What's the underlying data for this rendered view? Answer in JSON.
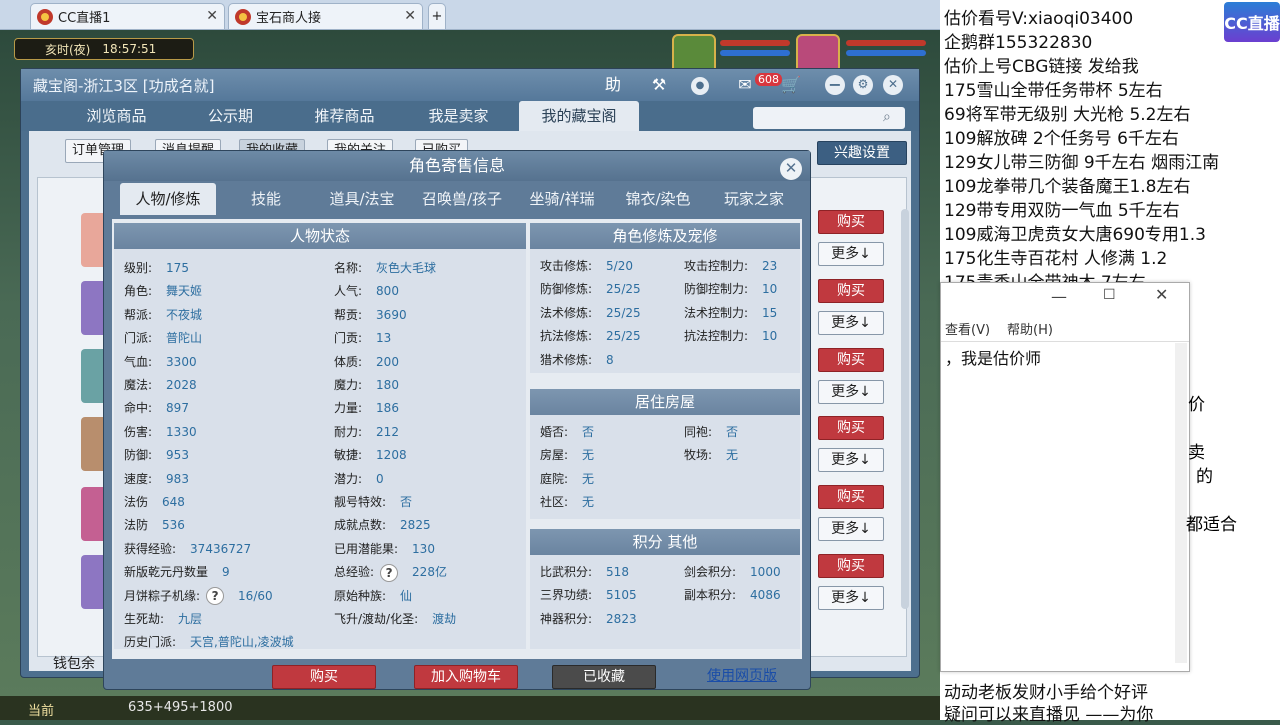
{
  "browser": {
    "tabs": [
      {
        "label": "CC直播1"
      },
      {
        "label": "宝石商人接"
      }
    ],
    "new_tab": "+"
  },
  "game": {
    "clock_label": "亥时(夜)",
    "time": "18:57:51",
    "coords": "635+495+1800",
    "bottom_label": "当前"
  },
  "cbg": {
    "title": "藏宝阁-浙江3区 [功成名就]",
    "help": "助",
    "badge": "608",
    "nav": [
      "浏览商品",
      "公示期",
      "推荐商品",
      "我是卖家",
      "我的藏宝阁"
    ],
    "subtabs": [
      "订单管理",
      "消息提醒",
      "我的收藏",
      "我的关注",
      "已购买",
      "浏览记录"
    ],
    "xingqu": "兴趣设置",
    "buy": "购买",
    "more": "更多↓",
    "wallet": "钱包余"
  },
  "modal": {
    "title": "角色寄售信息",
    "tabs": [
      "人物/修炼",
      "技能",
      "道具/法宝",
      "召唤兽/孩子",
      "坐骑/祥瑞",
      "锦衣/染色",
      "玩家之家"
    ],
    "status": {
      "title": "人物状态",
      "left": [
        {
          "k": "级别:",
          "v": "175"
        },
        {
          "k": "角色:",
          "v": "舞天姬"
        },
        {
          "k": "帮派:",
          "v": "不夜城"
        },
        {
          "k": "门派:",
          "v": "普陀山"
        },
        {
          "k": "气血:",
          "v": "3300"
        },
        {
          "k": "魔法:",
          "v": "2028"
        },
        {
          "k": "命中:",
          "v": "897"
        },
        {
          "k": "伤害:",
          "v": "1330"
        },
        {
          "k": "防御:",
          "v": "953"
        },
        {
          "k": "速度:",
          "v": "983"
        },
        {
          "k": "法伤",
          "v": "648"
        },
        {
          "k": "法防",
          "v": "536"
        },
        {
          "k": "获得经验:",
          "v": "37436727"
        },
        {
          "k": "新版乾元丹数量",
          "v": "9"
        },
        {
          "k": "月饼粽子机缘:",
          "v": "16/60"
        },
        {
          "k": "生死劫:",
          "v": "九层"
        },
        {
          "k": "历史门派:",
          "v": "天宫,普陀山,凌波城"
        }
      ],
      "right": [
        {
          "k": "名称:",
          "v": "灰色大毛球"
        },
        {
          "k": "人气:",
          "v": "800"
        },
        {
          "k": "帮贡:",
          "v": "3690"
        },
        {
          "k": "门贡:",
          "v": "13"
        },
        {
          "k": "体质:",
          "v": "200"
        },
        {
          "k": "魔力:",
          "v": "180"
        },
        {
          "k": "力量:",
          "v": "186"
        },
        {
          "k": "耐力:",
          "v": "212"
        },
        {
          "k": "敏捷:",
          "v": "1208"
        },
        {
          "k": "潜力:",
          "v": "0"
        },
        {
          "k": "靓号特效:",
          "v": "否"
        },
        {
          "k": "成就点数:",
          "v": "2825"
        },
        {
          "k": "已用潜能果:",
          "v": "130"
        },
        {
          "k": "总经验:",
          "v": "228亿"
        },
        {
          "k": "原始种族:",
          "v": "仙"
        },
        {
          "k": "飞升/渡劫/化圣:",
          "v": "渡劫"
        }
      ]
    },
    "cultivation": {
      "title": "角色修炼及宠修",
      "left": [
        {
          "k": "攻击修炼:",
          "v": "5/20"
        },
        {
          "k": "防御修炼:",
          "v": "25/25"
        },
        {
          "k": "法术修炼:",
          "v": "25/25"
        },
        {
          "k": "抗法修炼:",
          "v": "25/25"
        },
        {
          "k": "猎术修炼:",
          "v": "8"
        }
      ],
      "right": [
        {
          "k": "攻击控制力:",
          "v": "23"
        },
        {
          "k": "防御控制力:",
          "v": "10"
        },
        {
          "k": "法术控制力:",
          "v": "15"
        },
        {
          "k": "抗法控制力:",
          "v": "10"
        }
      ]
    },
    "house": {
      "title": "居住房屋",
      "left": [
        {
          "k": "婚否:",
          "v": "否"
        },
        {
          "k": "房屋:",
          "v": "无"
        },
        {
          "k": "庭院:",
          "v": "无"
        },
        {
          "k": "社区:",
          "v": "无"
        }
      ],
      "right": [
        {
          "k": "同袍:",
          "v": "否"
        },
        {
          "k": "牧场:",
          "v": "无"
        }
      ]
    },
    "points": {
      "title": "积分 其他",
      "left": [
        {
          "k": "比武积分:",
          "v": "518"
        },
        {
          "k": "三界功绩:",
          "v": "5105"
        },
        {
          "k": "神器积分:",
          "v": "2823"
        }
      ],
      "right": [
        {
          "k": "剑会积分:",
          "v": "1000"
        },
        {
          "k": "副本积分:",
          "v": "4086"
        }
      ]
    },
    "buttons": {
      "buy": "购买",
      "cart": "加入购物车",
      "fav": "已收藏",
      "web": "使用网页版"
    }
  },
  "stream": {
    "lines": [
      "估价看号V:xiaoqi03400",
      "企鹅群155322830",
      "估价上号CBG链接 发给我",
      "175雪山全带任务带杯 5左右",
      "69将军带无级别 大光枪 5.2左右",
      "109解放碑 2个任务号 6千左右",
      "129女儿带三防御 9千左右 烟雨江南",
      "109龙拳带几个装备魔王1.8左右",
      "129带专用双防一气血 5千左右",
      "109威海卫虎贲女大唐690专用1.3",
      "175化生寺百花村 人修满 1.2",
      "175青秀山全带神木 7左右"
    ],
    "notepad_menu": [
      "查看(V)",
      "帮助(H)"
    ],
    "notepad_text": "，我是估价师",
    "side_fragments": [
      "价",
      "卖",
      "的",
      "都适合"
    ],
    "bottom_lines": [
      "动动老板发财小手给个好评",
      "疑问可以来直播见 ——为你"
    ],
    "badge": "CC直播"
  }
}
